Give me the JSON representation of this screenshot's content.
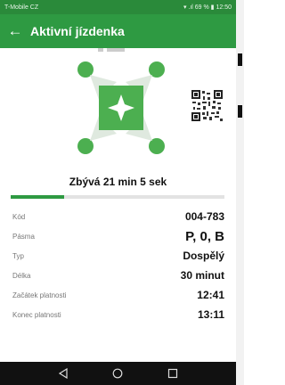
{
  "status_bar": {
    "carrier": "T-Mobile CZ",
    "indicators": "▾ .ıl 69 % ▮ 12:50"
  },
  "app_bar": {
    "back_icon": "arrow-left-icon",
    "title": "Aktivní jízdenka"
  },
  "ticket": {
    "remaining": "Zbývá 21 min 5 sek",
    "progress_fraction": 0.25,
    "details": [
      {
        "label": "Kód",
        "value": "004-783"
      },
      {
        "label": "Pásma",
        "value": "P, 0, B"
      },
      {
        "label": "Typ",
        "value": "Dospělý"
      },
      {
        "label": "Délka",
        "value": "30 minut"
      },
      {
        "label": "Začátek platnosti",
        "value": "12:41"
      },
      {
        "label": "Konec platnosti",
        "value": "13:11"
      }
    ]
  },
  "colors": {
    "primary": "#2e9a42",
    "status_bar": "#2a8a3a",
    "emblem_light": "#4caf50",
    "emblem_dark": "#2e7d32"
  },
  "nav_icons": [
    "back-triangle-icon",
    "home-circle-icon",
    "recents-square-icon"
  ]
}
